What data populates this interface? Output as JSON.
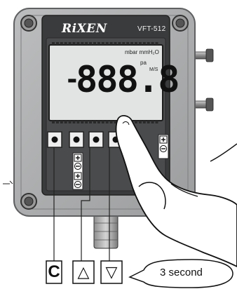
{
  "device": {
    "brand": "RiXEN",
    "model": "VFT-512"
  },
  "display": {
    "units_top": "mbar mmH₂O",
    "unit_pa": "pa",
    "unit_ms": "M/S",
    "minus": "-",
    "digits": "888.8"
  },
  "buttons": {
    "count": 4,
    "polarity_plus": "+",
    "polarity_minus": "−"
  },
  "key_legend": {
    "c_label": "C",
    "up_label": "△",
    "down_label": "▽"
  },
  "callout": {
    "text": "3 second"
  },
  "colors": {
    "housing": "#a9aaab",
    "housing_edge": "#5f6061",
    "bezel": "#3a3b3d",
    "lcd": "#e2e4e4"
  }
}
